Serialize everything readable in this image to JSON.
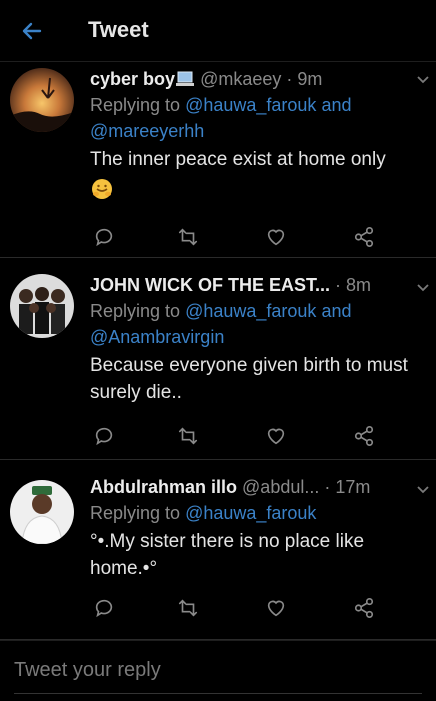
{
  "header": {
    "title": "Tweet",
    "back_icon": "arrow-left-icon",
    "accent": "#3b82c8"
  },
  "tweets": [
    {
      "name": "cyber boy",
      "name_badge": "laptop-emoji",
      "handle": "@mkaeey",
      "sep": "·",
      "time": "9m",
      "replying_prefix": "Replying to",
      "replying_to": [
        "@hauwa_farouk",
        "@mareeyerhh"
      ],
      "joiner": "and",
      "text": "The inner peace exist at home only",
      "emoji": "hugging-face-emoji"
    },
    {
      "name": "JOHN WICK OF THE EAST...",
      "handle": "",
      "sep": "·",
      "time": "8m",
      "replying_prefix": "Replying to",
      "replying_to": [
        "@hauwa_farouk",
        "@Anambravirgin"
      ],
      "joiner": "and",
      "text": "Because everyone given birth to must surely die.."
    },
    {
      "name": "Abdulrahman illo",
      "handle": "@abdul...",
      "sep": "·",
      "time": "17m",
      "replying_prefix": "Replying to",
      "replying_to": [
        "@hauwa_farouk"
      ],
      "text": "°•.My sister there is no place like home.•°"
    }
  ],
  "reply_box": {
    "placeholder": "Tweet your reply"
  }
}
